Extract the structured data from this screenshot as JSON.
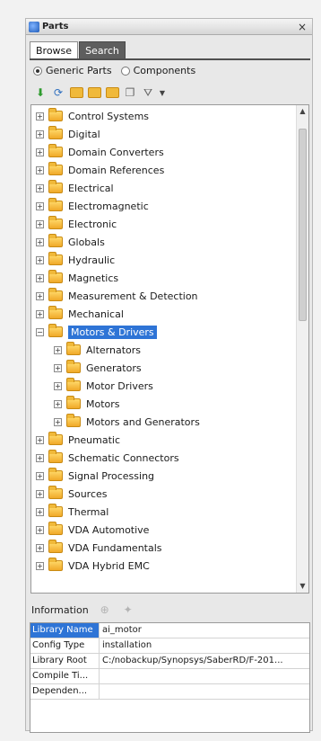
{
  "window": {
    "title": "Parts",
    "close_glyph": "×"
  },
  "tabs": [
    {
      "label": "Browse",
      "active": true
    },
    {
      "label": "Search",
      "active": false
    }
  ],
  "radio_options": [
    {
      "label": "Generic Parts",
      "selected": true
    },
    {
      "label": "Components",
      "selected": false
    }
  ],
  "toolbar_icons": [
    "arrow-down-icon",
    "refresh-icon",
    "folder-icon",
    "folder-arrow-icon",
    "folder-globe-icon",
    "copy-icon",
    "filter-icon",
    "dropdown-arrow-icon"
  ],
  "tree": {
    "items": [
      {
        "label": "Control Systems",
        "level": 0,
        "expanded": false,
        "selected": false
      },
      {
        "label": "Digital",
        "level": 0,
        "expanded": false,
        "selected": false
      },
      {
        "label": "Domain Converters",
        "level": 0,
        "expanded": false,
        "selected": false
      },
      {
        "label": "Domain References",
        "level": 0,
        "expanded": false,
        "selected": false
      },
      {
        "label": "Electrical",
        "level": 0,
        "expanded": false,
        "selected": false
      },
      {
        "label": "Electromagnetic",
        "level": 0,
        "expanded": false,
        "selected": false
      },
      {
        "label": "Electronic",
        "level": 0,
        "expanded": false,
        "selected": false
      },
      {
        "label": "Globals",
        "level": 0,
        "expanded": false,
        "selected": false
      },
      {
        "label": "Hydraulic",
        "level": 0,
        "expanded": false,
        "selected": false
      },
      {
        "label": "Magnetics",
        "level": 0,
        "expanded": false,
        "selected": false
      },
      {
        "label": "Measurement & Detection",
        "level": 0,
        "expanded": false,
        "selected": false
      },
      {
        "label": "Mechanical",
        "level": 0,
        "expanded": false,
        "selected": false
      },
      {
        "label": "Motors & Drivers",
        "level": 0,
        "expanded": true,
        "selected": true
      },
      {
        "label": "Alternators",
        "level": 1,
        "expanded": false,
        "selected": false
      },
      {
        "label": "Generators",
        "level": 1,
        "expanded": false,
        "selected": false
      },
      {
        "label": "Motor Drivers",
        "level": 1,
        "expanded": false,
        "selected": false
      },
      {
        "label": "Motors",
        "level": 1,
        "expanded": false,
        "selected": false
      },
      {
        "label": "Motors and Generators",
        "level": 1,
        "expanded": false,
        "selected": false
      },
      {
        "label": "Pneumatic",
        "level": 0,
        "expanded": false,
        "selected": false
      },
      {
        "label": "Schematic Connectors",
        "level": 0,
        "expanded": false,
        "selected": false
      },
      {
        "label": "Signal Processing",
        "level": 0,
        "expanded": false,
        "selected": false
      },
      {
        "label": "Sources",
        "level": 0,
        "expanded": false,
        "selected": false
      },
      {
        "label": "Thermal",
        "level": 0,
        "expanded": false,
        "selected": false
      },
      {
        "label": "VDA Automotive",
        "level": 0,
        "expanded": false,
        "selected": false
      },
      {
        "label": "VDA Fundamentals",
        "level": 0,
        "expanded": false,
        "selected": false
      },
      {
        "label": "VDA Hybrid EMC",
        "level": 0,
        "expanded": false,
        "selected": false
      }
    ]
  },
  "information": {
    "label": "Information",
    "icons": [
      "view-icon",
      "pin-icon"
    ],
    "rows": [
      {
        "key": "Library Name",
        "value": "ai_motor",
        "selected": true
      },
      {
        "key": "Config Type",
        "value": "installation",
        "selected": false
      },
      {
        "key": "Library Root",
        "value": "C:/nobackup/Synopsys/SaberRD/F-201...",
        "selected": false
      },
      {
        "key": "Compile Ti...",
        "value": "",
        "selected": false
      },
      {
        "key": "Dependen...",
        "value": "",
        "selected": false
      }
    ]
  },
  "colors": {
    "selection": "#2e74d6",
    "tab_inactive": "#5e5e5e",
    "folder": "#f0b93a"
  }
}
